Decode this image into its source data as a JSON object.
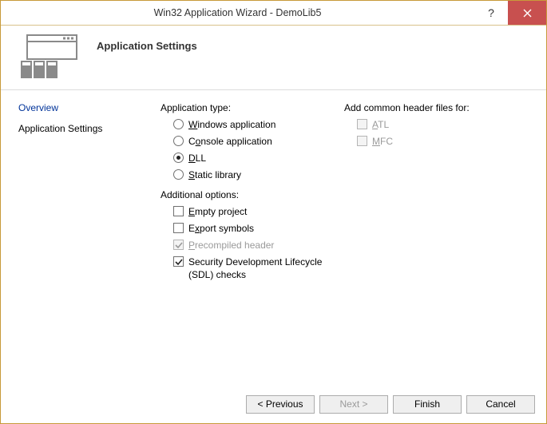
{
  "window": {
    "title": "Win32 Application Wizard - DemoLib5"
  },
  "banner": {
    "heading": "Application Settings"
  },
  "nav": {
    "items": [
      {
        "label": "Overview",
        "selected": false
      },
      {
        "label": "Application Settings",
        "selected": true
      }
    ]
  },
  "appType": {
    "heading": "Application type:",
    "options": [
      {
        "label": "Windows application"
      },
      {
        "label": "Console application"
      },
      {
        "label": "DLL"
      },
      {
        "label": "Static library"
      }
    ],
    "selected": "DLL"
  },
  "additional": {
    "heading": "Additional options:",
    "options": [
      {
        "label": "Empty project",
        "checked": false,
        "disabled": false
      },
      {
        "label": "Export symbols",
        "checked": false,
        "disabled": false
      },
      {
        "label": "Precompiled header",
        "checked": true,
        "disabled": true
      },
      {
        "label": "Security Development Lifecycle (SDL) checks",
        "checked": true,
        "disabled": false
      }
    ]
  },
  "headerFiles": {
    "heading": "Add common header files for:",
    "options": [
      {
        "label": "ATL",
        "checked": false,
        "disabled": true
      },
      {
        "label": "MFC",
        "checked": false,
        "disabled": true
      }
    ]
  },
  "buttons": {
    "previous": "< Previous",
    "next": "Next >",
    "finish": "Finish",
    "cancel": "Cancel"
  }
}
